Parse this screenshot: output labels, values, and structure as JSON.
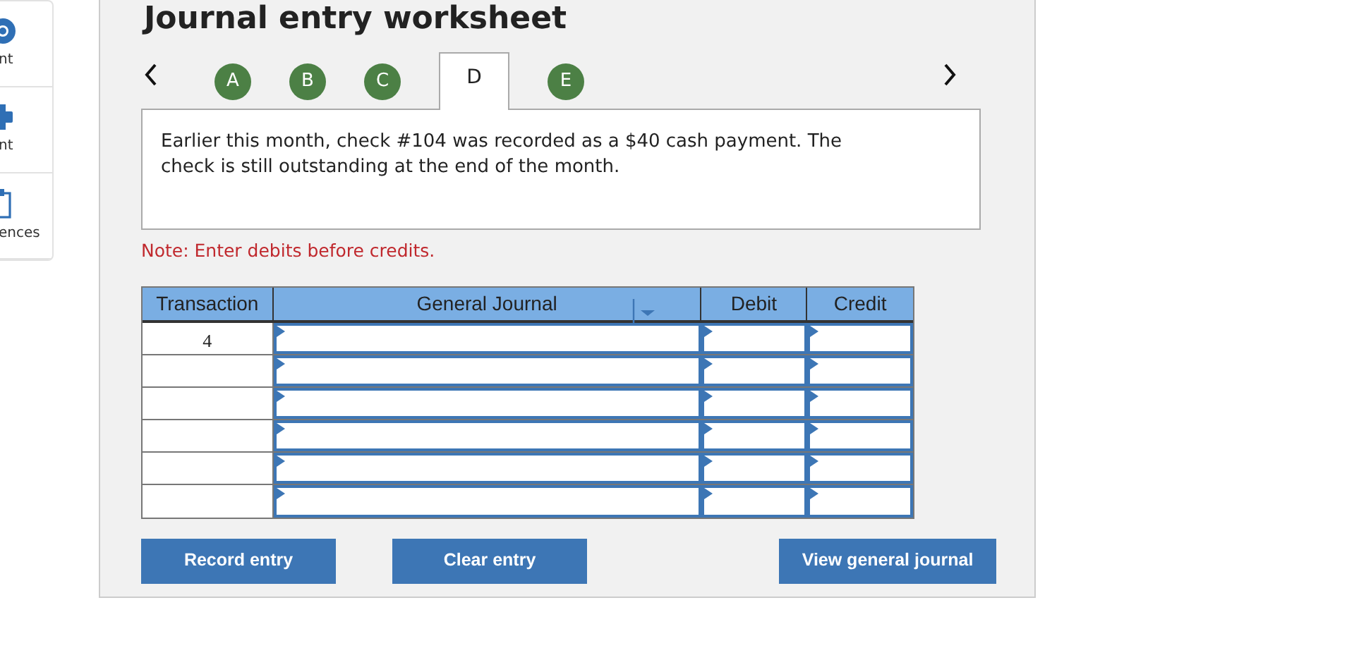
{
  "title": "Journal entry worksheet",
  "sidebar": {
    "items": [
      {
        "label": "nt",
        "kind": "help"
      },
      {
        "label": "nt",
        "kind": "print"
      },
      {
        "label": "ences",
        "kind": "references"
      }
    ]
  },
  "tabs": [
    {
      "label": "A",
      "selected": false
    },
    {
      "label": "B",
      "selected": false
    },
    {
      "label": "C",
      "selected": false
    },
    {
      "label": "D",
      "selected": true
    },
    {
      "label": "E",
      "selected": false
    }
  ],
  "prompt": "Earlier this month, check #104 was recorded as a $40 cash payment. The check is still outstanding at the end of the month.",
  "note": "Note: Enter debits before credits.",
  "table": {
    "columns": [
      "Transaction",
      "General Journal",
      "Debit",
      "Credit"
    ],
    "rows": [
      {
        "transaction": "4"
      },
      {},
      {},
      {},
      {},
      {}
    ]
  },
  "buttons": [
    "Record entry",
    "Clear entry",
    "View general journal"
  ]
}
